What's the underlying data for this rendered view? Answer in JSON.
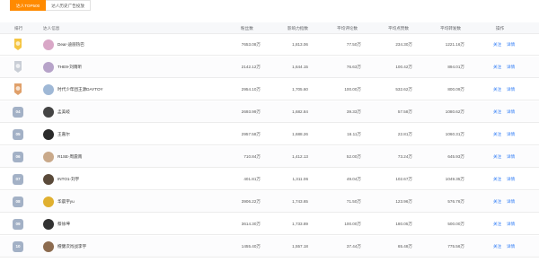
{
  "tabs": [
    {
      "label": "达人TOP500",
      "active": true
    },
    {
      "label": "达人历史广告投放",
      "active": false
    }
  ],
  "headers": {
    "rank": "排行",
    "info": "达人信息",
    "fans": "粉丝数",
    "like_rate": "影响力指数",
    "avg_comments": "平均评论数",
    "avg_likes": "平均点赞数",
    "avg_plays": "平均转发数",
    "ops": "操作"
  },
  "ops": {
    "follow": "关注",
    "detail": "详情"
  },
  "colors": {
    "accent": "#ff8a00",
    "link": "#2f7cf6",
    "badge": "#a3b1c6",
    "gold": "#f5c542",
    "silver": "#c9ced6",
    "bronze": "#e0a06a"
  },
  "rows": [
    {
      "rank": "1",
      "medal": "gold",
      "name": "Dear-迪丽热巴",
      "fans": "7653.08万",
      "index": "1,813.06",
      "comments": "77.50万",
      "likes": "234.30万",
      "shares": "1221.16万",
      "avatar": "#d9a7c7"
    },
    {
      "rank": "2",
      "medal": "silver",
      "name": "THE9-刘雨昕",
      "fans": "2142.12万",
      "index": "1,644.15",
      "comments": "76.63万",
      "likes": "100.42万",
      "shares": "894.01万",
      "avatar": "#b7a3c9"
    },
    {
      "rank": "3",
      "medal": "bronze",
      "name": "时代少年团王源DAYTOY",
      "fans": "2954.10万",
      "index": "1,705.60",
      "comments": "100.00万",
      "likes": "532.62万",
      "shares": "800.09万",
      "avatar": "#9fb8d6"
    },
    {
      "rank": "04",
      "medal": "",
      "name": "孟美岐",
      "fans": "2693.99万",
      "index": "1,682.84",
      "comments": "39.33万",
      "likes": "57.58万",
      "shares": "1080.62万",
      "avatar": "#444444"
    },
    {
      "rank": "05",
      "medal": "",
      "name": "王嘉尔",
      "fans": "2957.58万",
      "index": "1,688.26",
      "comments": "16.11万",
      "likes": "22.81万",
      "shares": "1060.31万",
      "avatar": "#2b2b2b"
    },
    {
      "rank": "06",
      "medal": "",
      "name": "R1SE-周震南",
      "fans": "710.84万",
      "index": "1,412.13",
      "comments": "52.00万",
      "likes": "73.24万",
      "shares": "645.93万",
      "avatar": "#c9a98a"
    },
    {
      "rank": "07",
      "medal": "",
      "name": "INTO1-刘宇",
      "fans": "401.81万",
      "index": "1,311.06",
      "comments": "49.04万",
      "likes": "102.67万",
      "shares": "1049.35万",
      "avatar": "#5a4a3a"
    },
    {
      "rank": "08",
      "medal": "",
      "name": "华晨宇yu",
      "fans": "3906.22万",
      "index": "1,743.65",
      "comments": "71.50万",
      "likes": "123.96万",
      "shares": "576.76万",
      "avatar": "#e0b030"
    },
    {
      "rank": "09",
      "medal": "",
      "name": "蔡徐坤",
      "fans": "3614.30万",
      "index": "1,733.89",
      "comments": "100.00万",
      "likes": "180.05万",
      "shares": "500.00万",
      "avatar": "#333333"
    },
    {
      "rank": "10",
      "medal": "",
      "name": "檀健次肖战李宇",
      "fans": "1455.40万",
      "index": "1,557.18",
      "comments": "37.44万",
      "likes": "65.48万",
      "shares": "775.56万",
      "avatar": "#8c6b4f"
    }
  ]
}
